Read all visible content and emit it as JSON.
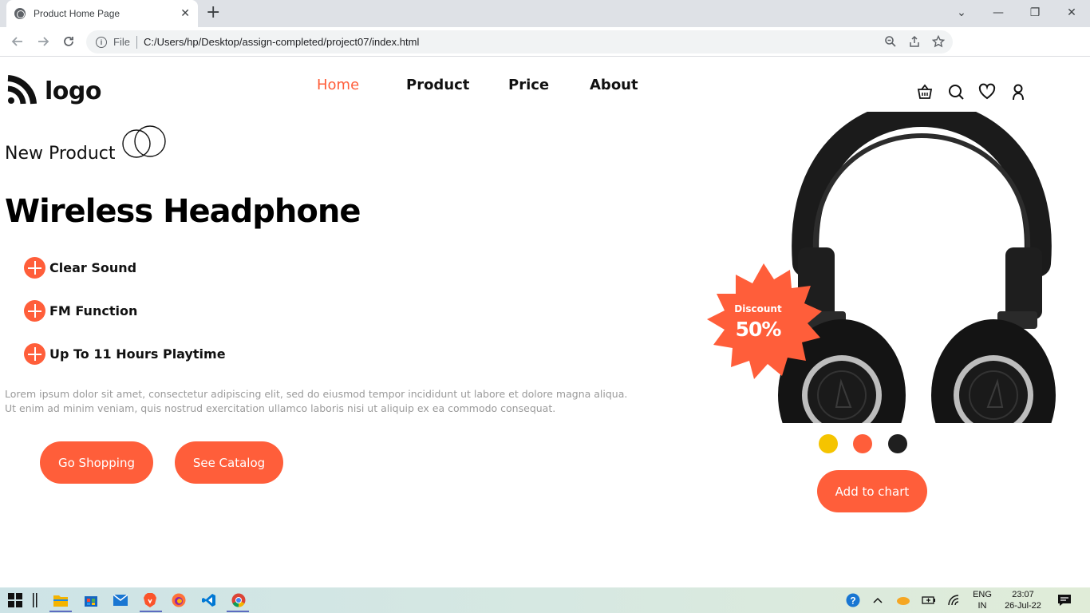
{
  "browser": {
    "tab_title": "Product Home Page",
    "tab_close": "✕",
    "new_tab": "+",
    "url_scheme": "File",
    "url": "C:/Users/hp/Desktop/assign-completed/project07/index.html",
    "window_controls": [
      "⌄",
      "—",
      "❐",
      "✕"
    ]
  },
  "header": {
    "logo_text": "logo",
    "nav": [
      "Home",
      "Product",
      "Price",
      "About"
    ],
    "active_nav": "Home",
    "icons": [
      "basket-icon",
      "search-icon",
      "heart-icon",
      "user-icon"
    ]
  },
  "hero": {
    "eyebrow": "New Product",
    "headline": "Wireless Headphone",
    "features": [
      "Clear Sound",
      "FM Function",
      "Up To 11 Hours Playtime"
    ],
    "description_line1": "Lorem ipsum dolor sit amet, consectetur adipiscing elit, sed do eiusmod tempor incididunt ut labore et dolore magna aliqua.",
    "description_line2": "Ut enim ad minim veniam, quis nostrud exercitation ullamco laboris nisi ut aliquip ex ea commodo consequat.",
    "primary_button": "Go Shopping",
    "secondary_button": "See Catalog"
  },
  "product": {
    "badge_label": "Discount",
    "badge_value": "50%",
    "color_options": [
      "#f5c400",
      "#ff5e3a",
      "#1f1f1f"
    ],
    "add_button": "Add to chart"
  },
  "colors": {
    "accent": "#ff5e3a",
    "text": "#111111",
    "muted": "#9a9a9a"
  },
  "taskbar": {
    "language": "ENG",
    "region": "IN",
    "time": "23:07",
    "date": "26-Jul-22"
  }
}
